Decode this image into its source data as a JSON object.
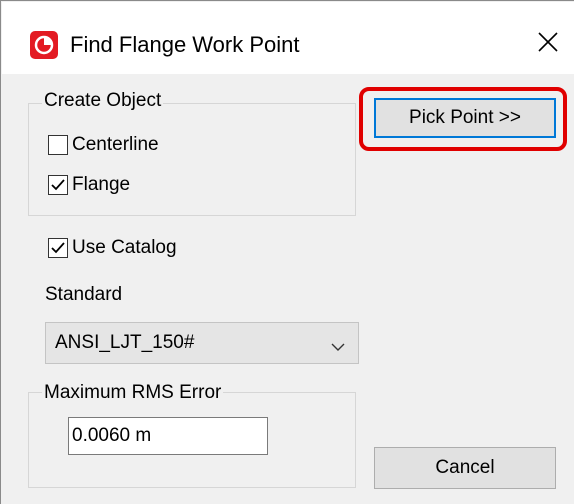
{
  "window": {
    "title": "Find Flange Work Point",
    "icon": "app-logo-icon",
    "close_icon": "close-icon"
  },
  "create_object": {
    "label": "Create Object",
    "centerline": {
      "label": "Centerline",
      "checked": false
    },
    "flange": {
      "label": "Flange",
      "checked": true
    }
  },
  "use_catalog": {
    "label": "Use Catalog",
    "checked": true
  },
  "standard": {
    "label": "Standard",
    "selected": "ANSI_LJT_150#"
  },
  "rms": {
    "label": "Maximum RMS Error",
    "value": "0.0060 m"
  },
  "buttons": {
    "pick_point": "Pick Point >>",
    "cancel": "Cancel"
  },
  "colors": {
    "accent": "#0078d7",
    "highlight": "#e00000",
    "logo": "#e31b23"
  }
}
